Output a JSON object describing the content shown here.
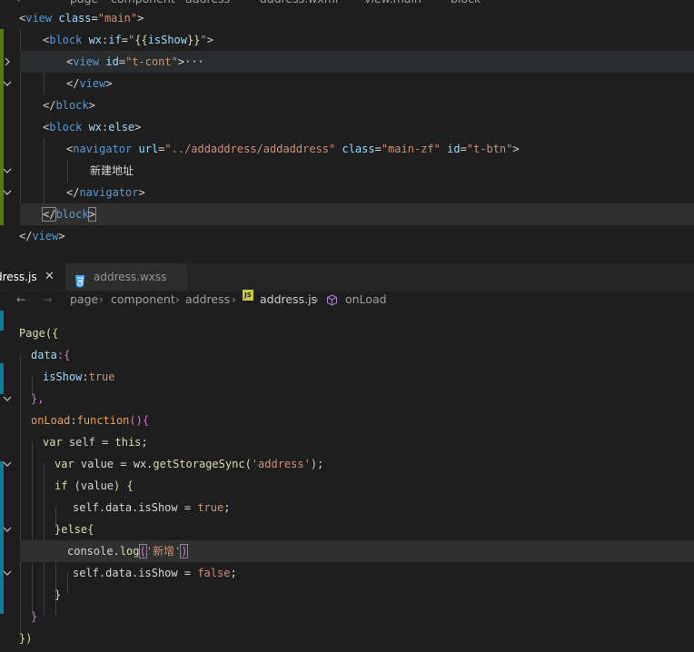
{
  "top_editor": {
    "breadcrumb": [
      "page",
      "component",
      "address",
      "address.wxml",
      "view.main",
      "block"
    ],
    "lines": [
      {
        "t": "view_main"
      },
      {
        "t": "block_if"
      },
      {
        "t": "view_tcont"
      },
      {
        "t": "view_close"
      },
      {
        "t": "block_close"
      },
      {
        "t": "block_else"
      },
      {
        "t": "navigator"
      },
      {
        "t": "text"
      },
      {
        "t": "navigator_close"
      },
      {
        "t": "block_close2"
      },
      {
        "t": "view_close2"
      }
    ],
    "code": {
      "l1": {
        "open": "<",
        "tag": "view",
        "attr": " class",
        "eq": "=",
        "val": "\"main\"",
        "close": ">"
      },
      "l2": {
        "open": "<",
        "tag": "block",
        "attr": " wx:if",
        "eq": "=",
        "q1": "\"",
        "b1": "{{",
        "var": "isShow",
        "b2": "}}",
        "q2": "\"",
        "close": ">"
      },
      "l3": {
        "open": "<",
        "tag": "view",
        "attr": " id",
        "eq": "=",
        "val": "\"t-cont\"",
        "close": ">",
        "ellipsis": "···"
      },
      "l4": {
        "open": "</",
        "tag": "view",
        "close": ">"
      },
      "l5": {
        "open": "</",
        "tag": "block",
        "close": ">"
      },
      "l6": {
        "open": "<",
        "tag": "block",
        "attr": " wx:else",
        "close": ">"
      },
      "l7": {
        "open": "<",
        "tag": "navigator",
        "a1": " url",
        "eq1": "=",
        "v1": "\"../addaddress/addaddress\"",
        "a2": " class",
        "eq2": "=",
        "v2": "\"main-zf\"",
        "a3": " id",
        "eq3": "=",
        "v3": "\"t-btn\"",
        "close": ">"
      },
      "l8": {
        "text": "新建地址"
      },
      "l9": {
        "open": "</",
        "tag": "navigator",
        "close": ">"
      },
      "l10": {
        "open": "</",
        "tag": "block",
        "close": ">"
      },
      "l11": {
        "open": "</",
        "tag": "view",
        "close": ">"
      }
    }
  },
  "tabs": [
    {
      "label": "dress.js",
      "close": "✕"
    },
    {
      "label": "address.wxss",
      "icon": "css-icon"
    }
  ],
  "bottom_editor": {
    "breadcrumb": [
      "page",
      "component",
      "address",
      "address.js",
      "onLoad"
    ],
    "js_badge": "JS",
    "code": {
      "l1": {
        "a": "Page",
        "b": "({"
      },
      "l2": {
        "a": "data",
        "b": ":{"
      },
      "l3": {
        "a": "isShow",
        "b": ":",
        "c": "true"
      },
      "l4": {
        "a": "},"
      },
      "l5": {
        "a": "onLoad",
        "b": ":",
        "c": "function",
        "d": "(){"
      },
      "l6": {
        "a": "var",
        "b": " self ",
        "c": "= ",
        "d": "this",
        "e": ";"
      },
      "l7": {
        "a": "var",
        "b": " value ",
        "c": "= ",
        "d": "wx",
        "e": ".",
        "f": "getStorageSync",
        "g": "(",
        "h": "'address'",
        "i": ");"
      },
      "l8": {
        "a": "if",
        "b": " (",
        "c": "value",
        "d": ") {"
      },
      "l9": {
        "a": "self",
        "b": ".",
        "c": "data",
        "d": ".",
        "e": "isShow",
        "f": " = ",
        "g": "true",
        "h": ";"
      },
      "l10": {
        "a": "}",
        "b": "else",
        "c": "{"
      },
      "l11": {
        "a": "console",
        "b": ".",
        "c": "log",
        "d": "(",
        "e": "'新增'",
        "f": ")"
      },
      "l12": {
        "a": "self",
        "b": ".",
        "c": "data",
        "d": ".",
        "e": "isShow",
        "f": " = ",
        "g": "false",
        "h": ";"
      },
      "l13": {
        "a": "}"
      },
      "l14": {
        "a": "}"
      },
      "l15": {
        "a": "})"
      }
    }
  },
  "colors": {
    "gutter_modified": "#587c0c",
    "gutter_added": "#0c7d9d",
    "background": "#1e1e1e"
  }
}
